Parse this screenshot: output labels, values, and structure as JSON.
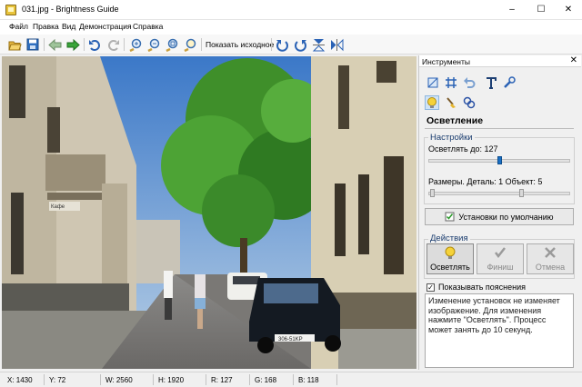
{
  "window": {
    "title": "031.jpg - Brightness Guide",
    "minimize": "–",
    "maximize": "☐",
    "close": "✕"
  },
  "menu": [
    "Файл",
    "Правка",
    "Вид",
    "Демонстрация",
    "Справка"
  ],
  "toolbar": {
    "show_original": "Показать исходное"
  },
  "photo": {
    "car_plate": "306-51KP",
    "shop_sign": "Кафе"
  },
  "panel": {
    "title": "Инструменты",
    "close": "✕",
    "section_title": "Осветление",
    "settings_group": "Настройки",
    "lighten_label": "Осветлять до: 127",
    "lighten_value": 127,
    "sizes_label": "Размеры. Деталь: 1  Объект: 5",
    "detail_value": 1,
    "object_value": 5,
    "default_button": "Установки по умолчанию",
    "actions_group": "Действия",
    "action_lighten": "Осветлять",
    "action_finish": "Финиш",
    "action_cancel": "Отмена",
    "show_hints_label": "Показывать пояснения",
    "show_hints_checked": true,
    "hint_text": "Изменение установок не изменяет изображение. Для изменения нажмите \"Осветлять\". Процесс может занять до 10 секунд."
  },
  "status": {
    "x": "X: 1430",
    "y": "Y: 72",
    "w": "W: 2560",
    "h": "H: 1920",
    "r": "R: 127",
    "g": "G: 168",
    "b": "B: 118"
  },
  "colors": {
    "accent": "#1a6fc4",
    "section_label": "#1a3c6e"
  }
}
